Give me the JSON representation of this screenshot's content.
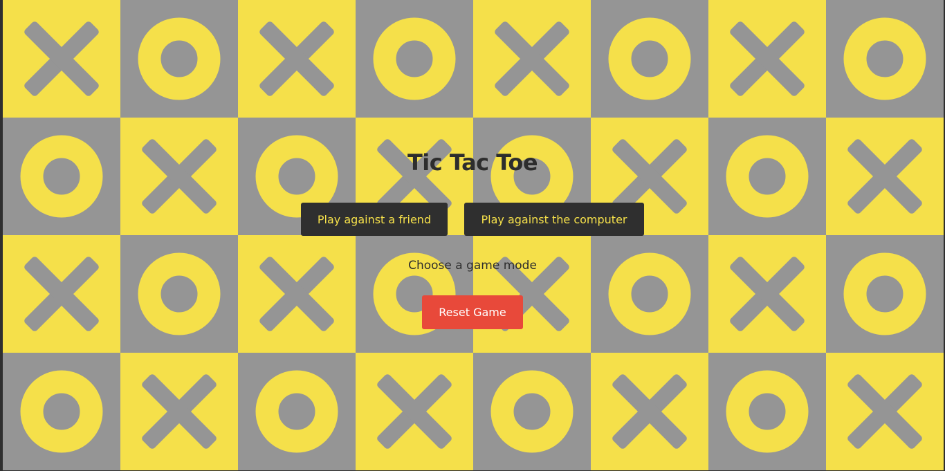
{
  "title": "Tic Tac Toe",
  "buttons": {
    "friend_label": "Play against a friend",
    "computer_label": "Play against the computer",
    "reset_label": "Reset Game"
  },
  "status": "Choose a game mode",
  "colors": {
    "yellow": "#f5e04a",
    "gray": "#959595",
    "dark": "#2f2f2f",
    "reset": "#e8493a"
  },
  "background_pattern": [
    [
      "x-on-yellow",
      "o-on-gray",
      "x-on-yellow",
      "o-on-gray",
      "x-on-yellow",
      "o-on-gray",
      "x-on-yellow",
      "o-on-gray"
    ],
    [
      "o-on-gray",
      "x-on-yellow",
      "o-on-gray",
      "x-on-yellow",
      "o-on-gray",
      "x-on-yellow",
      "o-on-gray",
      "x-on-yellow"
    ],
    [
      "x-on-yellow",
      "o-on-gray",
      "x-on-yellow",
      "o-on-gray",
      "x-on-yellow",
      "o-on-gray",
      "x-on-yellow",
      "o-on-gray"
    ],
    [
      "o-on-gray",
      "x-on-yellow",
      "o-on-gray",
      "x-on-yellow",
      "o-on-gray",
      "x-on-yellow",
      "o-on-gray",
      "x-on-yellow"
    ]
  ]
}
